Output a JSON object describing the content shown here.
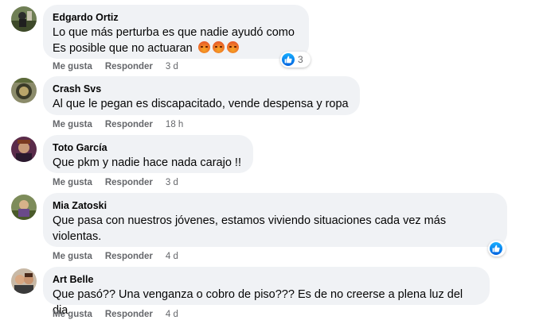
{
  "comments": [
    {
      "author": "Edgardo Ortiz",
      "lines": [
        "Lo que más perturba es que nadie ayudó como",
        "Es posible que no actuaran"
      ],
      "like": "Me gusta",
      "reply": "Responder",
      "time": "3 d",
      "reaction_count": "3",
      "emoji_icon": "angry-face-icon"
    },
    {
      "author": "Crash Svs",
      "lines": [
        "Al que le pegan es discapacitado, vende despensa y ropa"
      ],
      "like": "Me gusta",
      "reply": "Responder",
      "time": "18 h"
    },
    {
      "author": "Toto García",
      "lines": [
        "Que pkm y nadie hace nada carajo !!"
      ],
      "like": "Me gusta",
      "reply": "Responder",
      "time": "3 d"
    },
    {
      "author": "Mia Zatoski",
      "lines": [
        "Que pasa con nuestros jóvenes, estamos viviendo situaciones cada vez más",
        "violentas."
      ],
      "like": "Me gusta",
      "reply": "Responder",
      "time": "4 d"
    },
    {
      "author": "Art Belle",
      "lines": [
        "Que pasó?? Una venganza o cobro de piso??? Es de no creerse a plena luz del dia"
      ],
      "like": "Me gusta",
      "reply": "Responder",
      "time": "4 d"
    }
  ],
  "colors": {
    "bubble": "#f0f2f5",
    "meta": "#65676b",
    "like_blue": "#0866ff"
  }
}
